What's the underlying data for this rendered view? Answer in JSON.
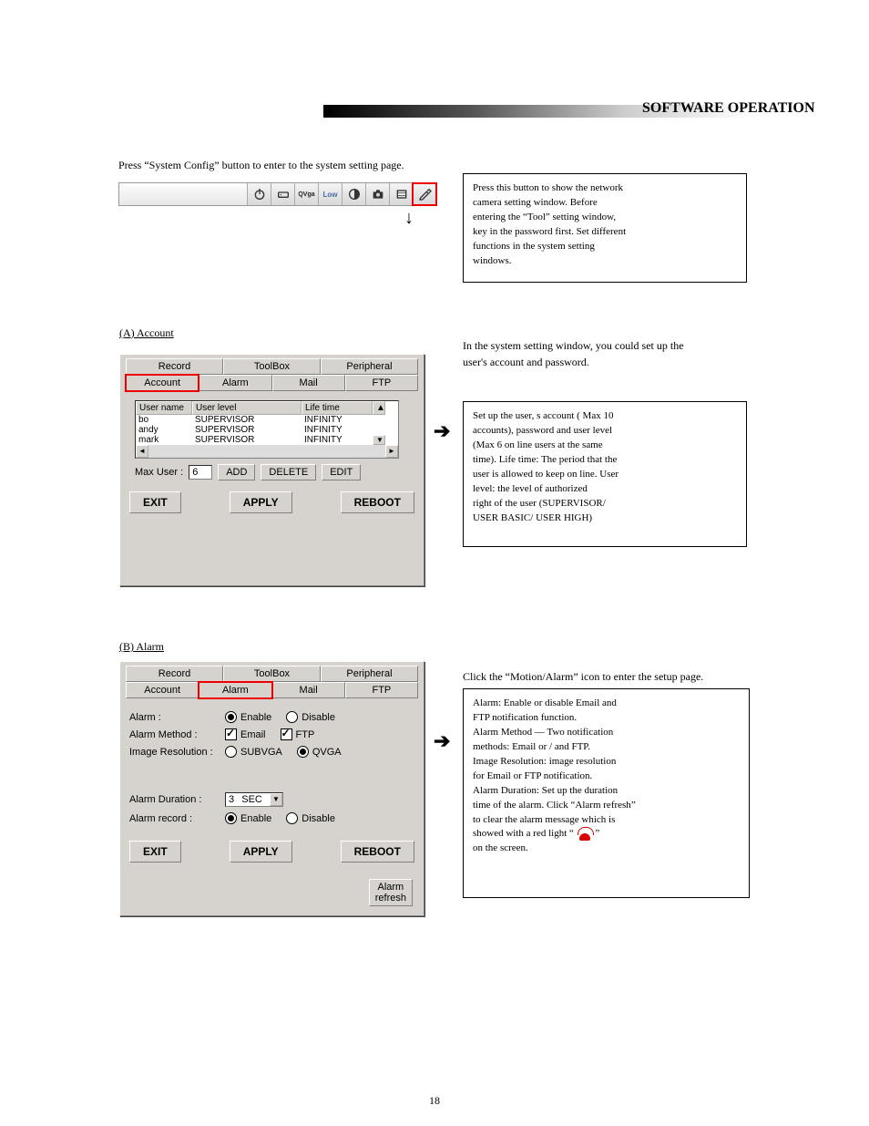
{
  "header": {
    "section": "SOFTWARE OPERATION"
  },
  "intro": {
    "quote_open": "“",
    "button_word": "System Config",
    "quote_close": "”",
    "rest": "button to enter to the system setting page."
  },
  "toolbar": {
    "qvga": "QVga",
    "low": "Low"
  },
  "callout1": {
    "line1": "Press this button to show the network",
    "line2": "camera setting window. Before",
    "line3a": "entering the",
    "ql": "“",
    "tool": "Tool",
    "qr": "”",
    "line3b": "setting window,",
    "line4": "key in the password first. Set different",
    "line5": "functions in the system setting",
    "line6": "windows."
  },
  "account": {
    "heading": "(A) Account",
    "rtext1": "In the system setting window",
    "comma": ",",
    "rtext2": "you could set up the",
    "rtext3": "user's account and password.",
    "cols": {
      "user": "User name",
      "level": "User level",
      "life": "Life time"
    },
    "rows": [
      {
        "user": "bo",
        "level": "SUPERVISOR",
        "life": "INFINITY"
      },
      {
        "user": "andy",
        "level": "SUPERVISOR",
        "life": "INFINITY"
      },
      {
        "user": "mark",
        "level": "SUPERVISOR",
        "life": "INFINITY"
      }
    ],
    "maxuser_label": "Max User :",
    "maxuser_value": "6",
    "btn_add": "ADD",
    "btn_delete": "DELETE",
    "btn_edit": "EDIT"
  },
  "callout2": {
    "l1a": "Set up the user",
    "comma": ",",
    "l1b": "s account ( Max 10",
    "l2": "accounts), password and user level",
    "l3": "(Max 6 on line users at the same",
    "l4": "time). Life time: The period that the",
    "l5": "user is allowed to keep on line. User",
    "l6": "level: the level of authorized",
    "l7": "right of the user (SUPERVISOR/",
    "l8": "USER BASIC/ USER HIGH)"
  },
  "alarm": {
    "heading": "(B) Alarm",
    "rtext1": "Click the",
    "ql": "“",
    "rtext_q": "Motion/Alarm",
    "qr": "”",
    "rtext2": "icon to enter the setup page.",
    "lbl_alarm": "Alarm :",
    "lbl_method": "Alarm Method :",
    "lbl_res": "Image Resolution :",
    "lbl_duration": "Alarm Duration :",
    "lbl_record": "Alarm record :",
    "opt_enable": "Enable",
    "opt_disable": "Disable",
    "opt_email": "Email",
    "opt_ftp": "FTP",
    "opt_subvga": "SUBVGA",
    "opt_qvga": "QVGA",
    "duration_val": "3",
    "duration_unit": "SEC",
    "btn_refresh1": "Alarm",
    "btn_refresh2": "refresh"
  },
  "callout3": {
    "l1": "Alarm: Enable or disable Email and",
    "l2": "FTP notification function.",
    "l3a": "Alarm Method",
    "l3b": "Two notification",
    "l4": "methods: Email or / and FTP.",
    "l5": "Image Resolution: image resolution",
    "l6": "for Email or FTP notification.",
    "l7": "Alarm Duration: Set up the duration",
    "l8a": "time of the alarm. Click",
    "ql": "“",
    "l8q": "Alarm refresh",
    "qr": "”",
    "l9": "to clear the alarm message which is",
    "l10a": "showed with a red light",
    "l11": "on the screen."
  },
  "dlg": {
    "tabs": {
      "record": "Record",
      "toolbox": "ToolBox",
      "peripheral": "Peripheral",
      "account": "Account",
      "alarm": "Alarm",
      "mail": "Mail",
      "ftp": "FTP"
    },
    "exit": "EXIT",
    "apply": "APPLY",
    "reboot": "REBOOT"
  },
  "page": {
    "number": "18"
  }
}
